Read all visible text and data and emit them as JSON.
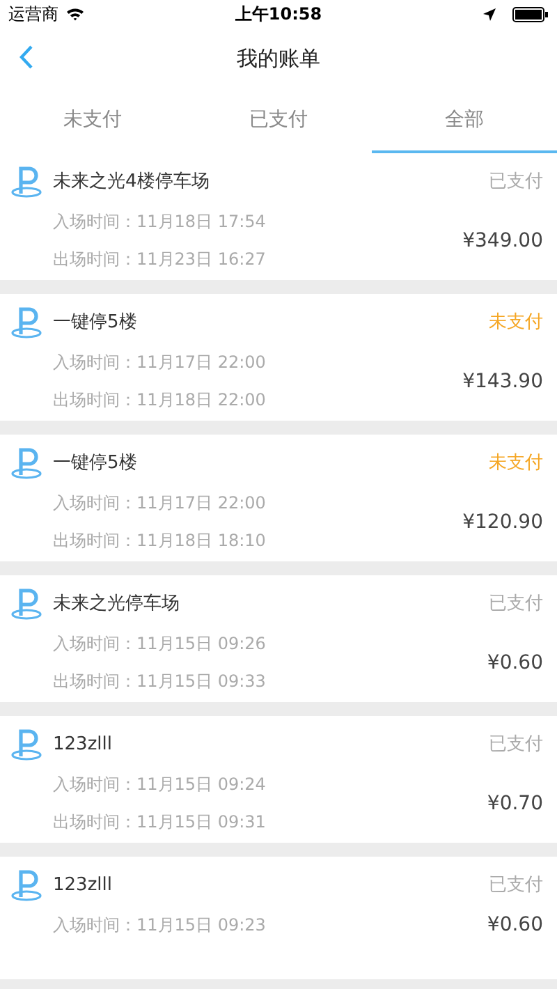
{
  "status_bar": {
    "carrier": "运营商",
    "time": "上午10:58"
  },
  "nav": {
    "title": "我的账单"
  },
  "tabs": [
    {
      "label": "未支付",
      "selected": false
    },
    {
      "label": "已支付",
      "selected": false
    },
    {
      "label": "全部",
      "selected": true
    }
  ],
  "bills": [
    {
      "name": "未来之光4楼停车场",
      "status": "已支付",
      "paid": true,
      "entry": "入场时间：11月18日 17:54",
      "exit": "出场时间：11月23日 16:27",
      "amount": "¥349.00"
    },
    {
      "name": "一键停5楼",
      "status": "未支付",
      "paid": false,
      "entry": "入场时间：11月17日 22:00",
      "exit": "出场时间：11月18日 22:00",
      "amount": "¥143.90"
    },
    {
      "name": "一键停5楼",
      "status": "未支付",
      "paid": false,
      "entry": "入场时间：11月17日 22:00",
      "exit": "出场时间：11月18日 18:10",
      "amount": "¥120.90"
    },
    {
      "name": "未来之光停车场",
      "status": "已支付",
      "paid": true,
      "entry": "入场时间：11月15日 09:26",
      "exit": "出场时间：11月15日 09:33",
      "amount": "¥0.60"
    },
    {
      "name": "123zlll",
      "status": "已支付",
      "paid": true,
      "entry": "入场时间：11月15日 09:24",
      "exit": "出场时间：11月15日 09:31",
      "amount": "¥0.70"
    },
    {
      "name": "123zlll",
      "status": "已支付",
      "paid": true,
      "entry": "入场时间：11月15日 09:23",
      "amount": "¥0.60"
    }
  ]
}
